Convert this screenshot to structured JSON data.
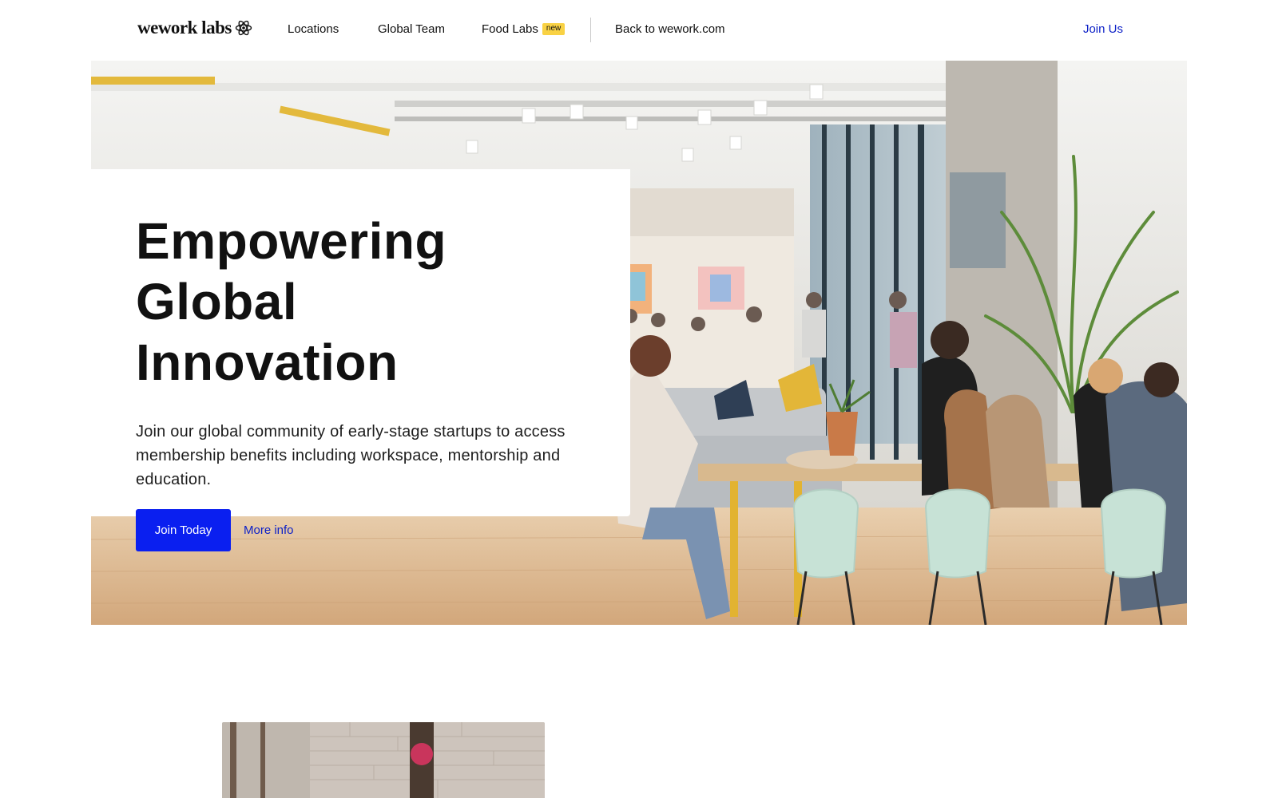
{
  "nav": {
    "logo_text": "wework labs",
    "logo_icon": "atom-icon",
    "links": {
      "locations": "Locations",
      "global_team": "Global Team",
      "food_labs": "Food Labs",
      "food_labs_badge": "new",
      "back": "Back to wework.com"
    },
    "join_us": "Join Us"
  },
  "hero": {
    "title_line1": "Empowering Global",
    "title_line2": "Innovation",
    "subtitle": "Join our global community of early-stage startups to access membership benefits including workspace, mentorship and education.",
    "primary_button": "Join Today",
    "secondary_link": "More info",
    "photo": "coworking-space-photo"
  },
  "below": {
    "photo": "brick-wall-office-photo"
  },
  "colors": {
    "accent_blue": "#0a1ff0",
    "link_blue": "#0b1fc7",
    "badge_yellow": "#f9d244",
    "text_dark": "#111111"
  }
}
